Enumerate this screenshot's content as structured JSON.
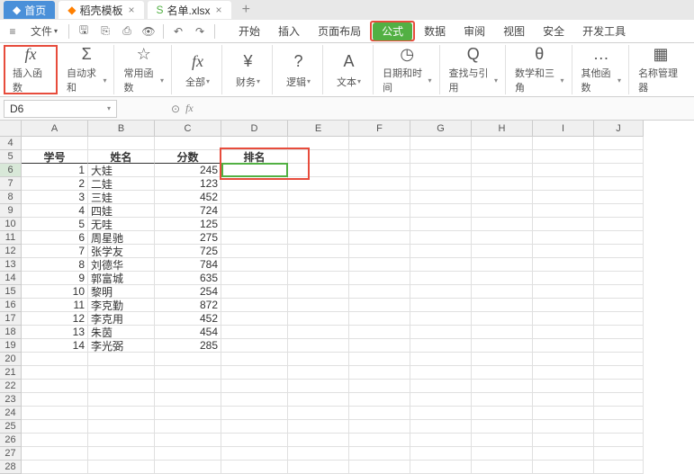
{
  "tabs": [
    {
      "icon": "◆",
      "label": "首页",
      "active": true
    },
    {
      "icon": "◆",
      "label": "稻壳模板"
    },
    {
      "icon": "S",
      "label": "名单.xlsx"
    }
  ],
  "file_menu": "文件",
  "menu_tabs": [
    "开始",
    "插入",
    "页面布局",
    "公式",
    "数据",
    "审阅",
    "视图",
    "安全",
    "开发工具"
  ],
  "active_menu": "公式",
  "ribbon": [
    {
      "label": "插入函数",
      "icon": "fx"
    },
    {
      "label": "自动求和",
      "icon": "Σ",
      "dd": true
    },
    {
      "label": "常用函数",
      "icon": "☆",
      "dd": true
    },
    {
      "label": "全部",
      "icon": "fx",
      "dd": true
    },
    {
      "label": "财务",
      "icon": "¥",
      "dd": true
    },
    {
      "label": "逻辑",
      "icon": "?",
      "dd": true
    },
    {
      "label": "文本",
      "icon": "A",
      "dd": true
    },
    {
      "label": "日期和时间",
      "icon": "◷",
      "dd": true
    },
    {
      "label": "查找与引用",
      "icon": "Q",
      "dd": true
    },
    {
      "label": "数学和三角",
      "icon": "θ",
      "dd": true
    },
    {
      "label": "其他函数",
      "icon": "…",
      "dd": true
    },
    {
      "label": "名称管理器",
      "icon": "▦"
    }
  ],
  "namebox": "D6",
  "fx_label": "fx",
  "cols": [
    "A",
    "B",
    "C",
    "D",
    "E",
    "F",
    "G",
    "H",
    "I",
    "J"
  ],
  "rows_start": 4,
  "headers": {
    "a": "学号",
    "b": "姓名",
    "c": "分数",
    "d": "排名"
  },
  "data": [
    {
      "a": 1,
      "b": "大娃",
      "c": 245
    },
    {
      "a": 2,
      "b": "二娃",
      "c": 123
    },
    {
      "a": 3,
      "b": "三娃",
      "c": 452
    },
    {
      "a": 4,
      "b": "四娃",
      "c": 724
    },
    {
      "a": 5,
      "b": "无哇",
      "c": 125
    },
    {
      "a": 6,
      "b": "周星驰",
      "c": 275
    },
    {
      "a": 7,
      "b": "张学友",
      "c": 725
    },
    {
      "a": 8,
      "b": "刘德华",
      "c": 784
    },
    {
      "a": 9,
      "b": "郭富城",
      "c": 635
    },
    {
      "a": 10,
      "b": "黎明",
      "c": 254
    },
    {
      "a": 11,
      "b": "李克勤",
      "c": 872
    },
    {
      "a": 12,
      "b": "李克用",
      "c": 452
    },
    {
      "a": 13,
      "b": "朱茵",
      "c": 454
    },
    {
      "a": 14,
      "b": "李光弼",
      "c": 285
    }
  ]
}
